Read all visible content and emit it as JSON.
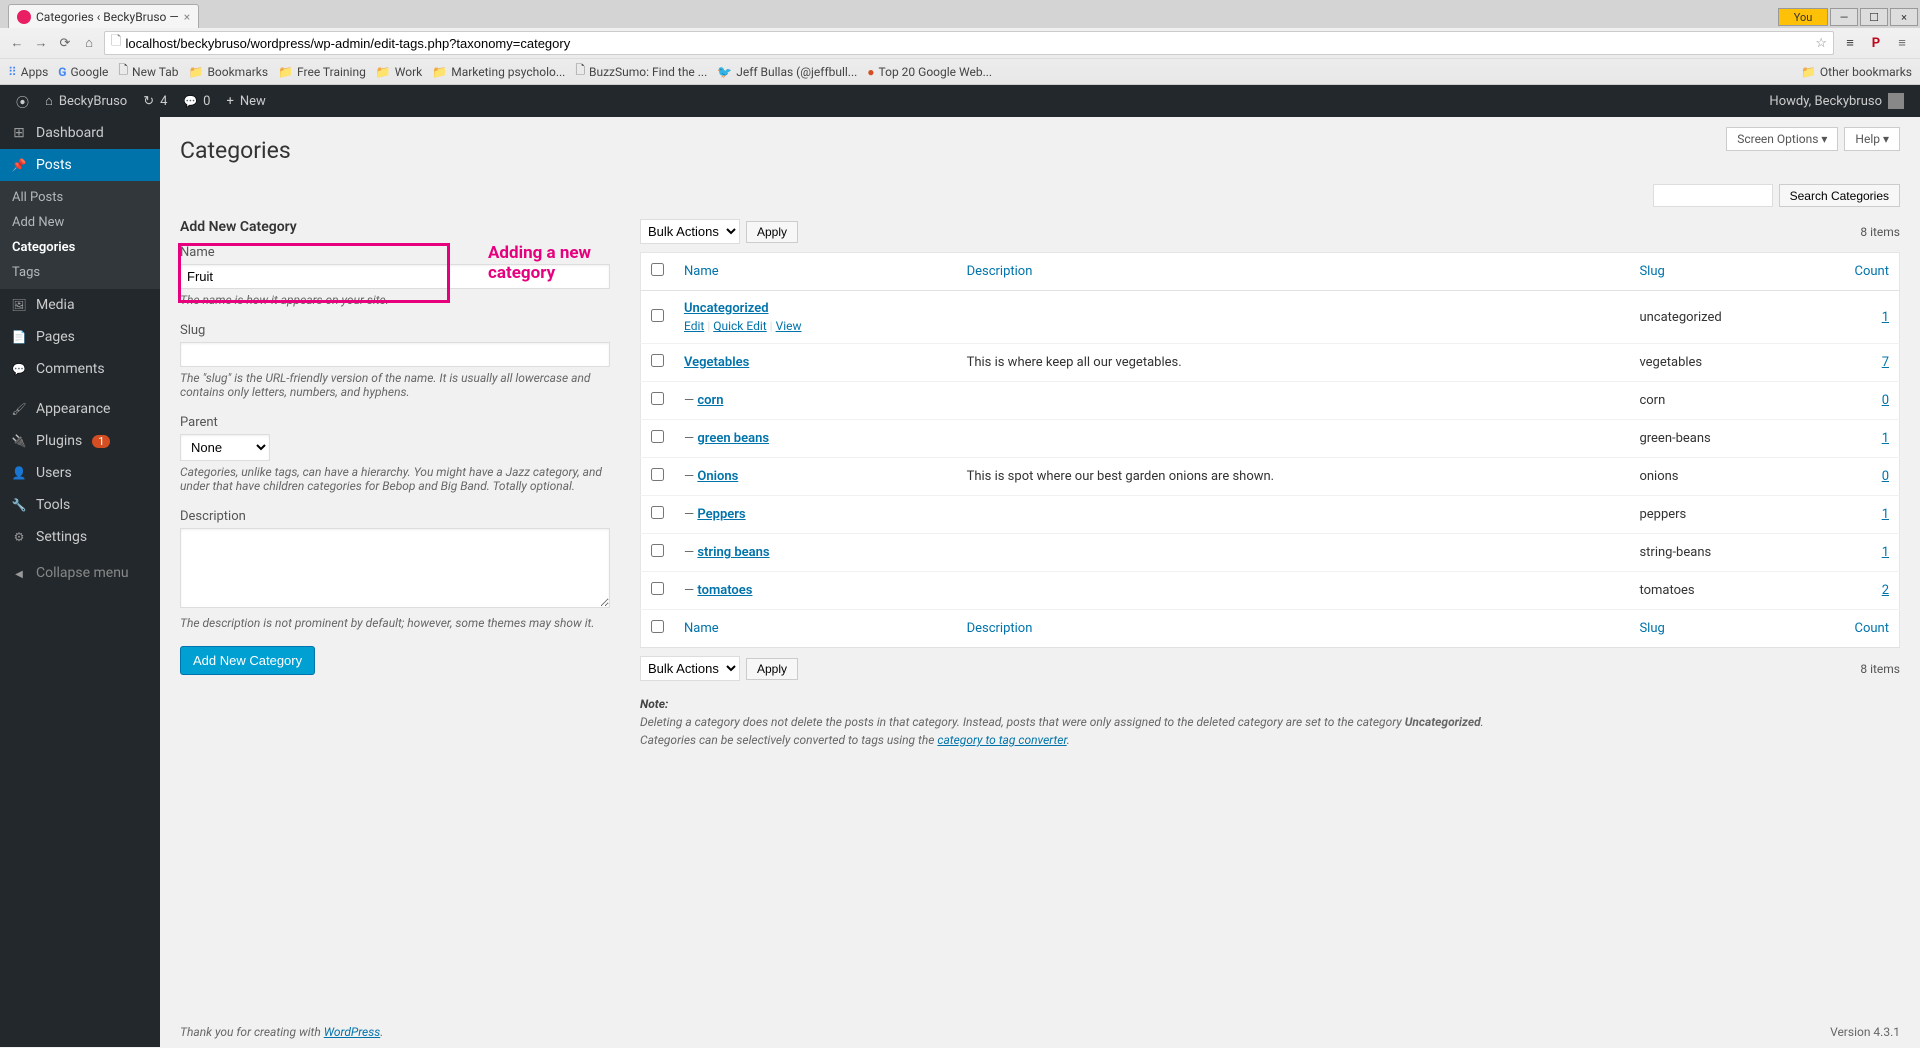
{
  "browser": {
    "tab_title": "Categories ‹ BeckyBruso —",
    "url": "localhost/beckybruso/wordpress/wp-admin/edit-tags.php?taxonomy=category",
    "you_label": "You",
    "bookmarks": {
      "apps": "Apps",
      "items": [
        "Google",
        "New Tab",
        "Bookmarks",
        "Free Training",
        "Work",
        "Marketing psycholo...",
        "BuzzSumo: Find the ...",
        "Jeff Bullas (@jeffbull...",
        "Top 20 Google Web..."
      ],
      "other": "Other bookmarks"
    }
  },
  "adminbar": {
    "site": "BeckyBruso",
    "updates": "4",
    "comments": "0",
    "new": "New",
    "howdy": "Howdy, Beckybruso"
  },
  "sidebar": {
    "dashboard": "Dashboard",
    "posts": "Posts",
    "posts_sub": [
      "All Posts",
      "Add New",
      "Categories",
      "Tags"
    ],
    "media": "Media",
    "pages": "Pages",
    "comments": "Comments",
    "appearance": "Appearance",
    "plugins": "Plugins",
    "plugins_badge": "1",
    "users": "Users",
    "tools": "Tools",
    "settings": "Settings",
    "collapse": "Collapse menu"
  },
  "page": {
    "title": "Categories",
    "screen_options": "Screen Options ▾",
    "help": "Help ▾"
  },
  "form": {
    "heading": "Add New Category",
    "name_label": "Name",
    "name_value": "Fruit",
    "name_help": "The name is how it appears on your site.",
    "slug_label": "Slug",
    "slug_help": "The \"slug\" is the URL-friendly version of the name. It is usually all lowercase and contains only letters, numbers, and hyphens.",
    "parent_label": "Parent",
    "parent_value": "None",
    "parent_help": "Categories, unlike tags, can have a hierarchy. You might have a Jazz category, and under that have children categories for Bebop and Big Band. Totally optional.",
    "desc_label": "Description",
    "desc_help": "The description is not prominent by default; however, some themes may show it.",
    "submit": "Add New Category"
  },
  "annotation": "Adding a new category",
  "table": {
    "search_btn": "Search Categories",
    "bulk": "Bulk Actions",
    "apply": "Apply",
    "count_text": "8 items",
    "headers": {
      "name": "Name",
      "description": "Description",
      "slug": "Slug",
      "count": "Count"
    },
    "row_actions": {
      "edit": "Edit",
      "quick": "Quick Edit",
      "view": "View"
    },
    "rows": [
      {
        "name": "Uncategorized",
        "desc": "",
        "slug": "uncategorized",
        "count": "1",
        "child": false,
        "show_actions": true
      },
      {
        "name": "Vegetables",
        "desc": "This is where keep all our vegetables.",
        "slug": "vegetables",
        "count": "7",
        "child": false
      },
      {
        "name": "corn",
        "desc": "",
        "slug": "corn",
        "count": "0",
        "child": true
      },
      {
        "name": "green beans",
        "desc": "",
        "slug": "green-beans",
        "count": "1",
        "child": true
      },
      {
        "name": "Onions",
        "desc": "This is spot where our best garden onions are shown.",
        "slug": "onions",
        "count": "0",
        "child": true
      },
      {
        "name": "Peppers",
        "desc": "",
        "slug": "peppers",
        "count": "1",
        "child": true
      },
      {
        "name": "string beans",
        "desc": "",
        "slug": "string-beans",
        "count": "1",
        "child": true
      },
      {
        "name": "tomatoes",
        "desc": "",
        "slug": "tomatoes",
        "count": "2",
        "child": true
      }
    ]
  },
  "note": {
    "title": "Note:",
    "line1a": "Deleting a category does not delete the posts in that category. Instead, posts that were only assigned to the deleted category are set to the category ",
    "line1b": "Uncategorized",
    "line2a": "Categories can be selectively converted to tags using the ",
    "line2b": "category to tag converter"
  },
  "footer": {
    "thanks": "Thank you for creating with ",
    "wp": "WordPress",
    "version": "Version 4.3.1"
  }
}
